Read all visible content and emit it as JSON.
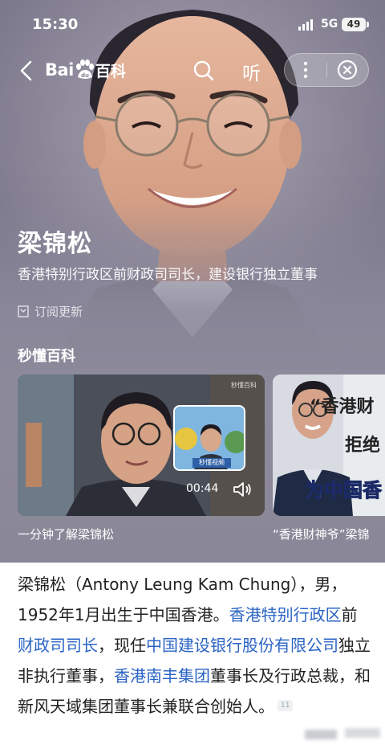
{
  "status_bar": {
    "time": "15:30",
    "network": "5G",
    "battery": "49"
  },
  "nav": {
    "logo_text": "Bai",
    "logo_mark": "du",
    "logo_suffix": "百科",
    "listen_label": "听",
    "icons": [
      "back-icon",
      "search-icon",
      "more-icon",
      "close-icon"
    ]
  },
  "hero": {
    "name": "梁锦松",
    "description": "香港特别行政区前财政司司长，建设银行独立董事",
    "subscribe_label": "订阅更新"
  },
  "quick_section": {
    "title": "秒懂百科",
    "videos": [
      {
        "caption": "一分钟了解梁锦松",
        "duration": "00:44",
        "watermark": "秒懂百科",
        "mini_label": "秒懂视频"
      },
      {
        "caption": "“香港财神爷”梁锦",
        "overlay_lines": [
          "“香港财",
          "拒绝",
          "为中国香"
        ]
      }
    ]
  },
  "article": {
    "intro_parts": [
      {
        "text": "梁锦松（Antony Leung Kam Chung），男，1952年1月出生于中国香港。",
        "link": false
      },
      {
        "text": "香港特别行政区",
        "link": true
      },
      {
        "text": "前",
        "link": false
      },
      {
        "text": "财政司司长",
        "link": true
      },
      {
        "text": "，现任",
        "link": false
      },
      {
        "text": "中国建设银行股份有限公司",
        "link": true
      },
      {
        "text": "独立非执行董事，",
        "link": false
      },
      {
        "text": "香港南丰集团",
        "link": true
      },
      {
        "text": "董事长及行政总裁，和新风天域集团董事长兼联合创始人。",
        "link": false
      }
    ],
    "reference": "11"
  },
  "colors": {
    "link": "#2b64c4",
    "text": "#222222",
    "hero_bg": "#8d8a9c"
  }
}
